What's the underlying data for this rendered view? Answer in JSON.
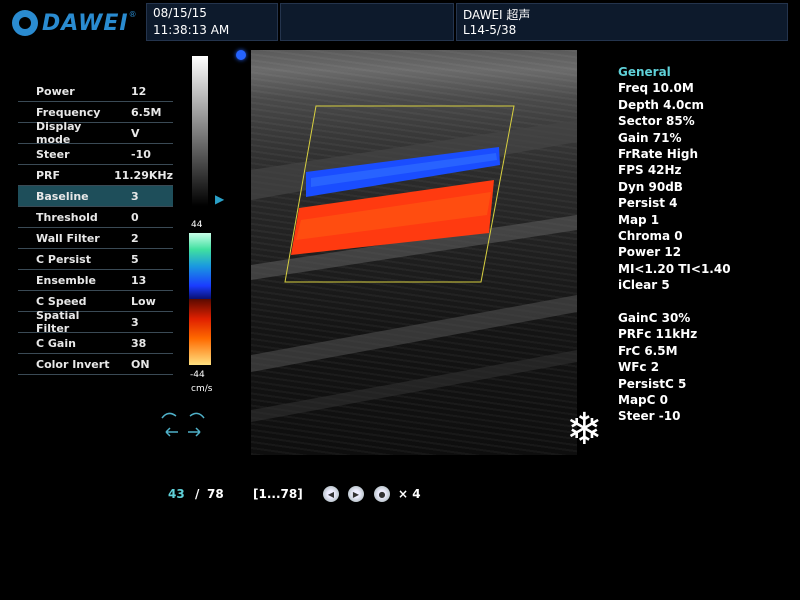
{
  "header": {
    "brand": "DAWEI",
    "date": "08/15/15",
    "time": "11:38:13 AM",
    "device_name": "DAWEI 超声",
    "probe_info": "L14-5/38"
  },
  "params": [
    {
      "name": "Power",
      "value": "12"
    },
    {
      "name": "Frequency",
      "value": "6.5M"
    },
    {
      "name": "Display mode",
      "value": "V"
    },
    {
      "name": "Steer",
      "value": "-10"
    },
    {
      "name": "PRF",
      "value": "11.29KHz"
    },
    {
      "name": "Baseline",
      "value": "3",
      "selected": true
    },
    {
      "name": "Threshold",
      "value": "0"
    },
    {
      "name": "Wall Filter",
      "value": "2"
    },
    {
      "name": "C Persist",
      "value": "5"
    },
    {
      "name": "Ensemble",
      "value": "13"
    },
    {
      "name": "C Speed",
      "value": "Low"
    },
    {
      "name": "Spatial Filter",
      "value": "3"
    },
    {
      "name": "C Gain",
      "value": "38"
    },
    {
      "name": "Color Invert",
      "value": "ON"
    }
  ],
  "color_scale": {
    "max": "44",
    "min": "-44",
    "unit": "cm/s"
  },
  "info": {
    "heading": "General",
    "lines": [
      "Freq 10.0M",
      "Depth 4.0cm",
      "Sector 85%",
      "Gain 71%",
      "FrRate High",
      "FPS 42Hz",
      "Dyn 90dB",
      "Persist 4",
      "Map 1",
      "Chroma 0",
      "Power 12",
      "MI<1.20  TI<1.40",
      "iClear 5"
    ]
  },
  "color_info": {
    "lines": [
      "GainC 30%",
      "PRFc 11kHz",
      "FrC 6.5M",
      "WFc 2",
      "PersistC 5",
      "MapC 0",
      "Steer -10"
    ]
  },
  "cine": {
    "current": "43",
    "separator": "/",
    "total": "78",
    "range": "[1...78]",
    "speed": "× 4"
  },
  "colors": {
    "accent": "#5fd0d8",
    "selected_row": "#1e4e5a",
    "roi_box": "#d8d040",
    "flow_blue": "#1a4dff",
    "flow_red": "#ff3a10"
  },
  "icons": {
    "freeze": "snowflake-icon",
    "probe": "probe-orientation-icon",
    "cine_prev": "rewind-icon",
    "cine_play": "play-icon",
    "cine_next": "forward-icon"
  }
}
